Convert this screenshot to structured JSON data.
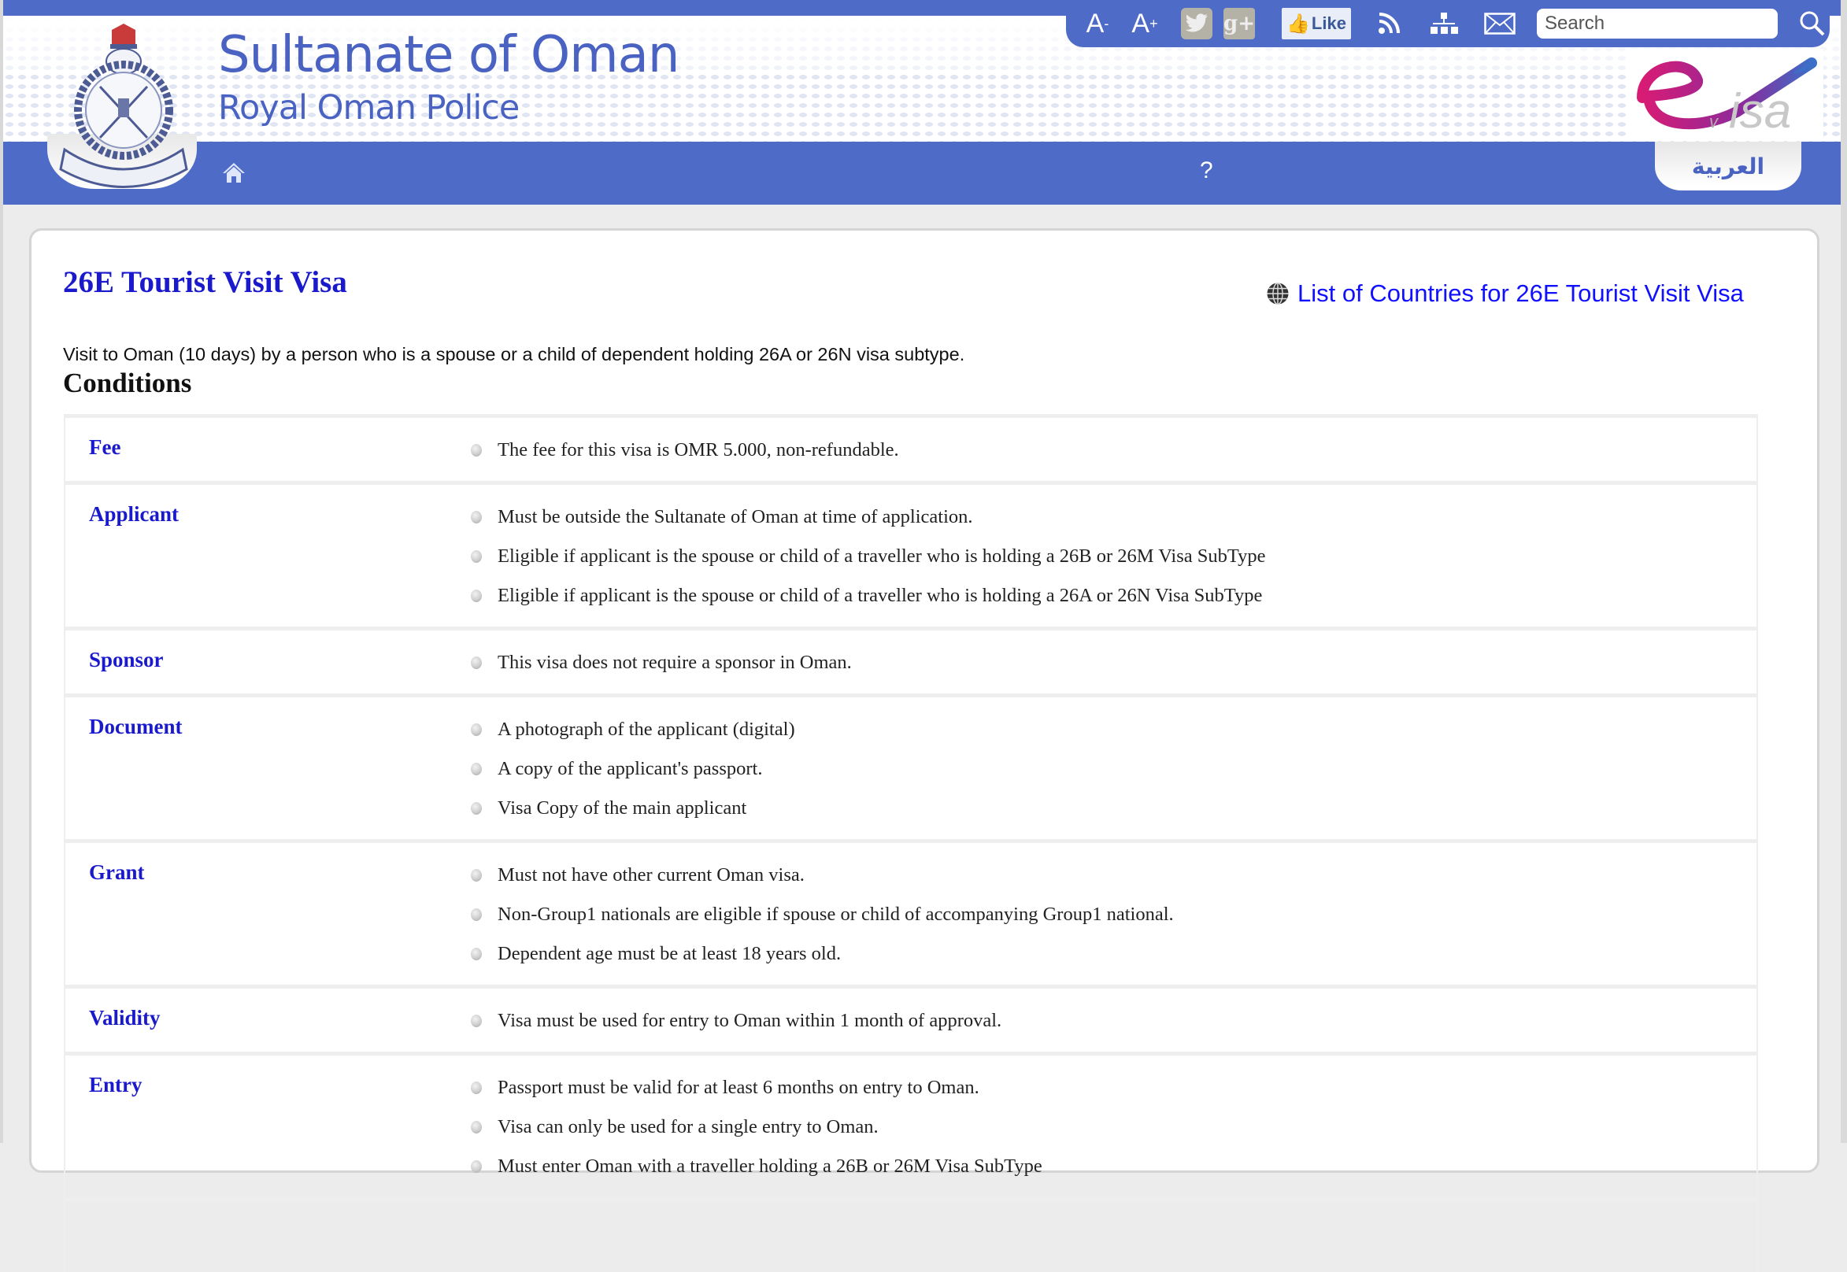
{
  "header": {
    "site_title": "Sultanate of Oman",
    "site_subtitle": "Royal Oman Police",
    "help_label": "?",
    "language_label": "العربية",
    "brand_color": "#4f6bc8"
  },
  "toolbar": {
    "font_decrease_label": "A",
    "font_decrease_sup": "-",
    "font_increase_label": "A",
    "font_increase_sup": "+",
    "google_plus_label": "g+",
    "like_label": "Like",
    "search_placeholder": "Search"
  },
  "page": {
    "title": "26E Tourist Visit Visa",
    "countries_link": "List of Countries for 26E Tourist Visit Visa",
    "description": "Visit to Oman (10 days) by a person who is a spouse or a child of dependent holding 26A or 26N visa subtype.",
    "conditions_heading": "Conditions",
    "link_color": "#1010ff",
    "heading_color": "#1a1acc"
  },
  "conditions": [
    {
      "label": "Fee",
      "items": [
        "The fee for this visa is OMR 5.000, non-refundable."
      ]
    },
    {
      "label": "Applicant",
      "items": [
        "Must be outside the Sultanate of Oman at time of application.",
        "Eligible if applicant is the spouse or child of a traveller who is holding a 26B or 26M Visa SubType",
        "Eligible if applicant is the spouse or child of a traveller who is holding a 26A or 26N Visa SubType"
      ]
    },
    {
      "label": "Sponsor",
      "items": [
        "This visa does not require a sponsor in Oman."
      ]
    },
    {
      "label": "Document",
      "items": [
        "A photograph of the applicant (digital)",
        "A copy of the applicant's passport.",
        "Visa Copy of the main applicant"
      ]
    },
    {
      "label": "Grant",
      "items": [
        "Must not have other current Oman visa.",
        "Non-Group1 nationals are eligible if spouse or child of accompanying Group1 national.",
        "Dependent age must be at least 18 years old."
      ]
    },
    {
      "label": "Validity",
      "items": [
        "Visa must be used for entry to Oman within 1 month of approval."
      ]
    },
    {
      "label": "Entry",
      "items": [
        "Passport must be valid for at least 6 months on entry to Oman.",
        "Visa can only be used for a single entry to Oman.",
        "Must enter Oman with a traveller holding a 26B or 26M Visa SubType"
      ]
    },
    {
      "label": "",
      "items": []
    }
  ]
}
